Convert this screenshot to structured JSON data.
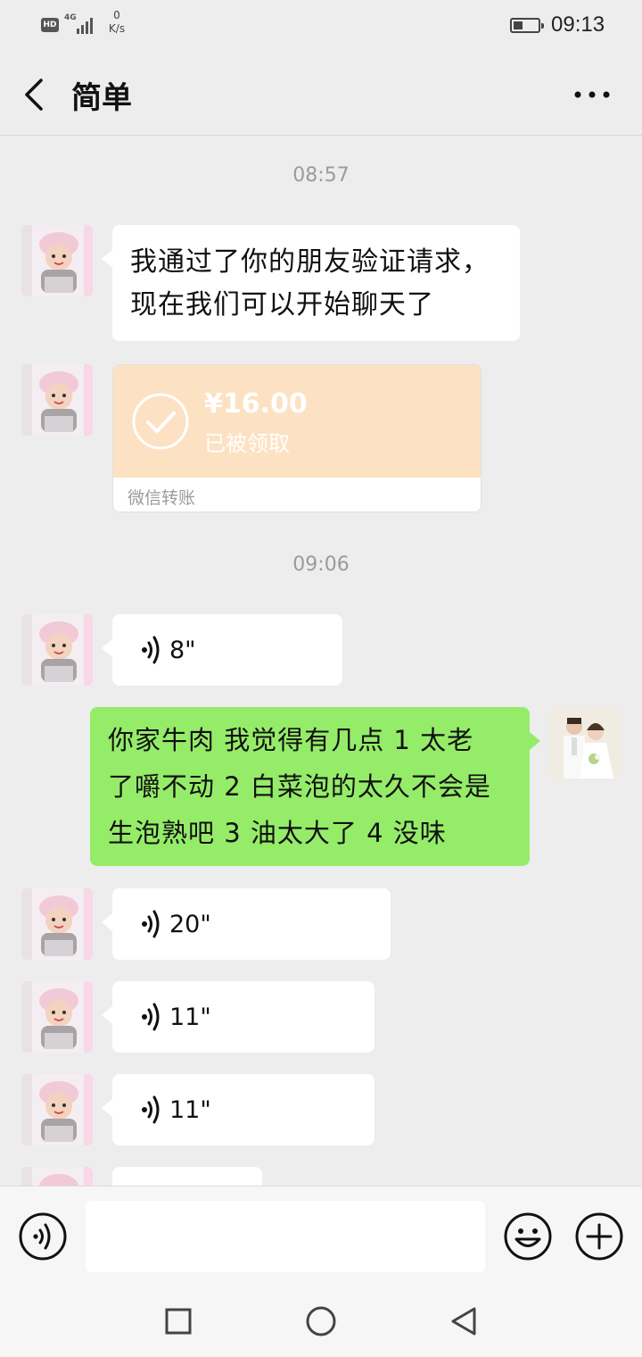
{
  "status_bar": {
    "hd": "HD",
    "network": "4G",
    "speed_value": "0",
    "speed_unit": "K/s",
    "time": "09:13"
  },
  "header": {
    "title": "简单"
  },
  "messages": {
    "t1": "08:57",
    "m1": "我通过了你的朋友验证请求，\n现在我们可以开始聊天了",
    "transfer": {
      "amount": "¥16.00",
      "status": "已被领取",
      "footer": "微信转账"
    },
    "t2": "09:06",
    "v1": "8\"",
    "m2": "你家牛肉 我觉得有几点 1 太老\n了嚼不动 2 白菜泡的太久不会是\n生泡熟吧 3 油太大了 4 没味",
    "v2": "20\"",
    "v3": "11\"",
    "v4": "11\""
  },
  "input": {
    "value": ""
  },
  "colors": {
    "background": "#ededed",
    "bubble_self": "#95ec69",
    "bubble_other": "#ffffff",
    "transfer": "#fde1c3"
  }
}
